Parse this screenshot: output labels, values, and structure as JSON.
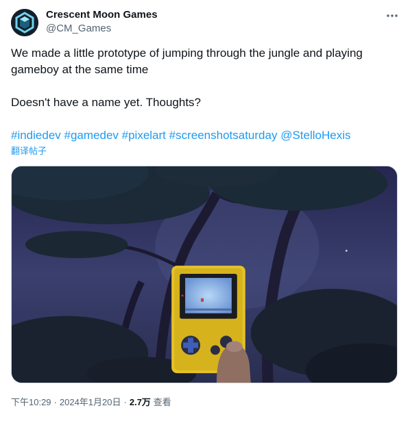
{
  "author": {
    "name": "Crescent Moon Games",
    "handle": "@CM_Games"
  },
  "tweet": {
    "line1": "We made a little prototype of jumping through the jungle and playing",
    "line2": "gameboy at the same time",
    "line3": "Doesn't have a name yet. Thoughts?",
    "tags": [
      "#indiedev",
      "#gamedev",
      "#pixelart",
      "#screenshotsaturday",
      "@StelloHexis"
    ],
    "translate_label": "翻译帖子"
  },
  "meta": {
    "time": "下午10:29",
    "date": "2024年1月20日",
    "views": "2.7万",
    "views_label": "查看"
  },
  "icons": {
    "more": "more-horizontal-icon",
    "avatar": "hexagon-logo"
  },
  "colors": {
    "link": "#1d9bf0",
    "text": "#0f1419",
    "secondary": "#536471"
  }
}
